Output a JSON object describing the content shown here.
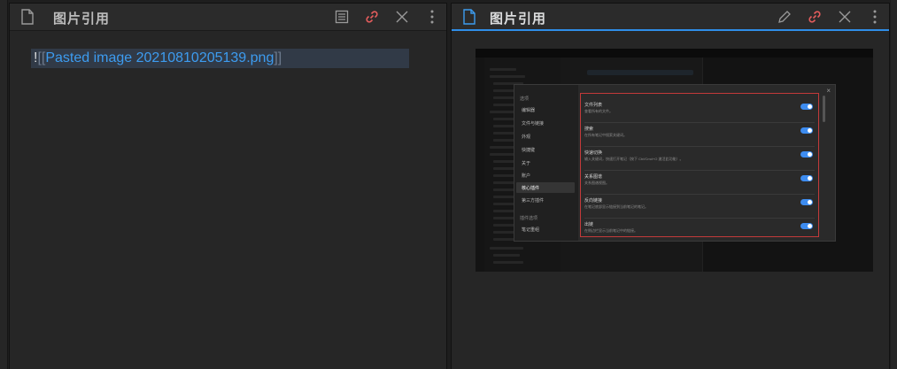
{
  "left_pane": {
    "tab_title": "图片引用",
    "editor": {
      "bang": "!",
      "open_brackets": "[[",
      "link_text": "Pasted image 20210810205139.png",
      "close_brackets": "]]"
    }
  },
  "right_pane": {
    "tab_title": "图片引用",
    "embedded_screenshot": {
      "settings_sidebar": {
        "section_options": "选项",
        "items": [
          "编辑器",
          "文件与链接",
          "外观",
          "快捷键",
          "关于",
          "账户",
          "核心插件",
          "第三方插件"
        ],
        "active_item": "核心插件",
        "section_plugin_options": "插件选项",
        "plugin_items": [
          "笔记重组"
        ]
      },
      "core_plugins": [
        {
          "title": "文件列表",
          "desc": "查看所有的文件。"
        },
        {
          "title": "搜索",
          "desc": "在所有笔记中搜索关键词。"
        },
        {
          "title": "快速切换",
          "desc": "输入关键词，快速打开笔记（按下 Ctrl/Cmd+O 激活此功能）。"
        },
        {
          "title": "关系图谱",
          "desc": "关系图谱视图。"
        },
        {
          "title": "反向链接",
          "desc": "在笔记底部显示链接到当前笔记的笔记。"
        },
        {
          "title": "出链",
          "desc": "在侧边栏显示当前笔记中的链接。"
        }
      ]
    }
  },
  "colors": {
    "accent": "#2f8ee8",
    "link": "#3d9cf0",
    "highlight_box": "#c33a3a",
    "pin_icon": "#e25c5c"
  },
  "icons": [
    "file-icon",
    "reading-view-icon",
    "edit-icon",
    "link-icon",
    "close-icon",
    "more-options-icon"
  ]
}
